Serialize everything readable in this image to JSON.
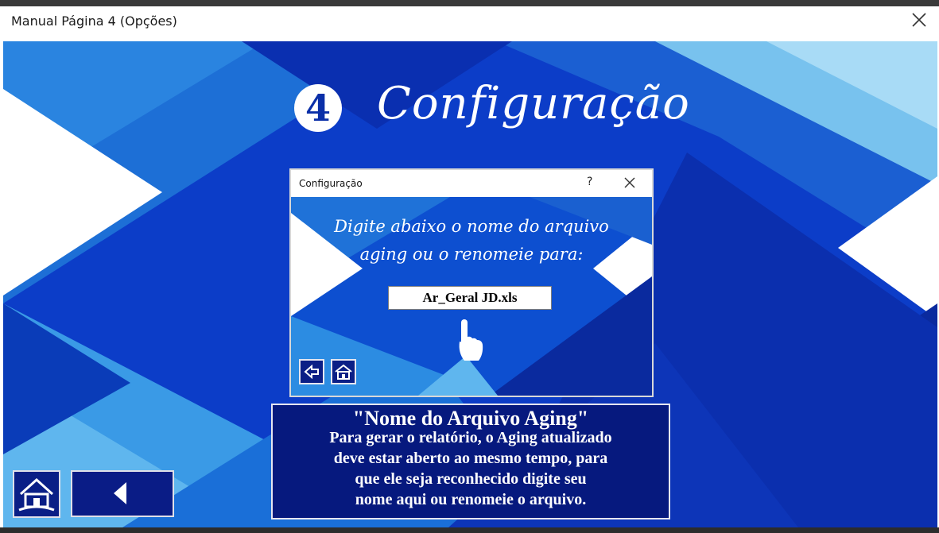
{
  "window": {
    "title": "Manual Página 4 (Opções)"
  },
  "page": {
    "step_number": "4",
    "heading": "Configuração"
  },
  "dialog": {
    "title": "Configuração",
    "help_label": "?",
    "message_line1": "Digite abaixo o nome do arquivo",
    "message_line2": "aging ou o renomeie para:",
    "filename_value": "Ar_Geral JD.xls"
  },
  "info_box": {
    "title": "\"Nome do Arquivo Aging\"",
    "lines": [
      "Para gerar o relatório, o Aging atualizado",
      "deve estar aberto ao mesmo tempo, para",
      "que ele seja reconhecido digite seu",
      "nome aqui ou renomeie o arquivo."
    ]
  },
  "icons": {
    "window_close": "close-icon",
    "dialog_close": "close-icon",
    "dialog_back": "arrow-left-icon",
    "dialog_home": "home-icon",
    "home": "home-icon",
    "back": "triangle-left-icon",
    "pointer": "hand-pointer-icon"
  },
  "colors": {
    "accent": "#0a3fc7",
    "dark_panel": "#06197e",
    "light_blue": "#7ec8ee"
  }
}
